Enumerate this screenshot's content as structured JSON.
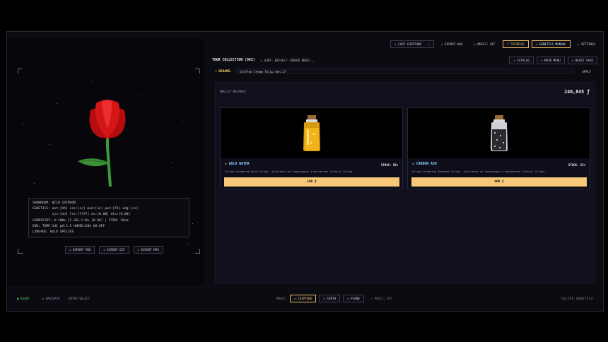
{
  "top_toolbar": {
    "palette_select": "◇ COZY CHIPTUNE",
    "export_wav": "◇ EXPORT WAV",
    "music_toggle": "◇ MUSIC: OFF",
    "tutorial": "? TUTORIAL",
    "genetics_manual": "◇ GENETICS MANUAL",
    "settings": "◇ SETTINGS"
  },
  "showroom": {
    "info_lines": [
      "SHOWROOM: WILD CRIMSON",
      "GENETICS: ant:[AA] cas:[cc] mod:[nn] pet:[55] edg:[ss]",
      "          sys:[nn] fre:[ffff] av:[0.00] dia:[0.00]",
      "CHEMISTRY: A:100% [1.30] C:0% [0.00] | STEM: 30cm",
      "ENV: TEMP:14C pH:5.5 HUMID:50% UV:OFF",
      "LINEAGE: WILD SPECIES"
    ],
    "export_png": "◇ EXPORT PNG",
    "export_gif": "◇ EXPORT GIF",
    "export_mp4": "◇ EXPORT MP4"
  },
  "collection": {
    "title": "YOUR COLLECTION (963)",
    "sort": "◇ SORT: DEFAULT (ORDER BRED) ⌄",
    "catalog": "◇ CATALOG",
    "main_menu": "◇ MAIN MENU",
    "reset_save": "◇ RESET SAVE"
  },
  "rename": {
    "label": "✎ RENAME:",
    "value": "Chiffon Cream Tulip Gen.17",
    "apply": "APPLY"
  },
  "wallet": {
    "label": "WALLET BALANCE",
    "value": "246,845 ƒ"
  },
  "shop": [
    {
      "tic": "◇",
      "name": "GOLD WATER",
      "stock": "STOCK: 50%",
      "desc": "Allows breeding Gold tulips. Activates on homozygous transparent (Glass) tulips.",
      "price": "100 ƒ"
    },
    {
      "tic": "◇",
      "name": "CARBON ASH",
      "stock": "STOCK: 25%",
      "desc": "Allows breeding Diamond tulips. Activates on homozygous transparent (Glass) tulips.",
      "price": "900 ƒ"
    }
  ],
  "statusbar": {
    "ready": "● READY",
    "hotkey1": "⇆ NAVIGATE",
    "hotkey2": "ENTER SELECT",
    "music_label": "MUSIC:",
    "chiptune": "◇ CHIPTUNE",
    "synth": "◇ SYNTH",
    "piano": "◇ PIANO",
    "music_off": "◇ MUSIC: OFF",
    "brand": "TULIPA GENETICA"
  },
  "colors": {
    "accent": "#f6c877",
    "ready": "#4fd06a",
    "title_blue": "#8fd0ff"
  }
}
